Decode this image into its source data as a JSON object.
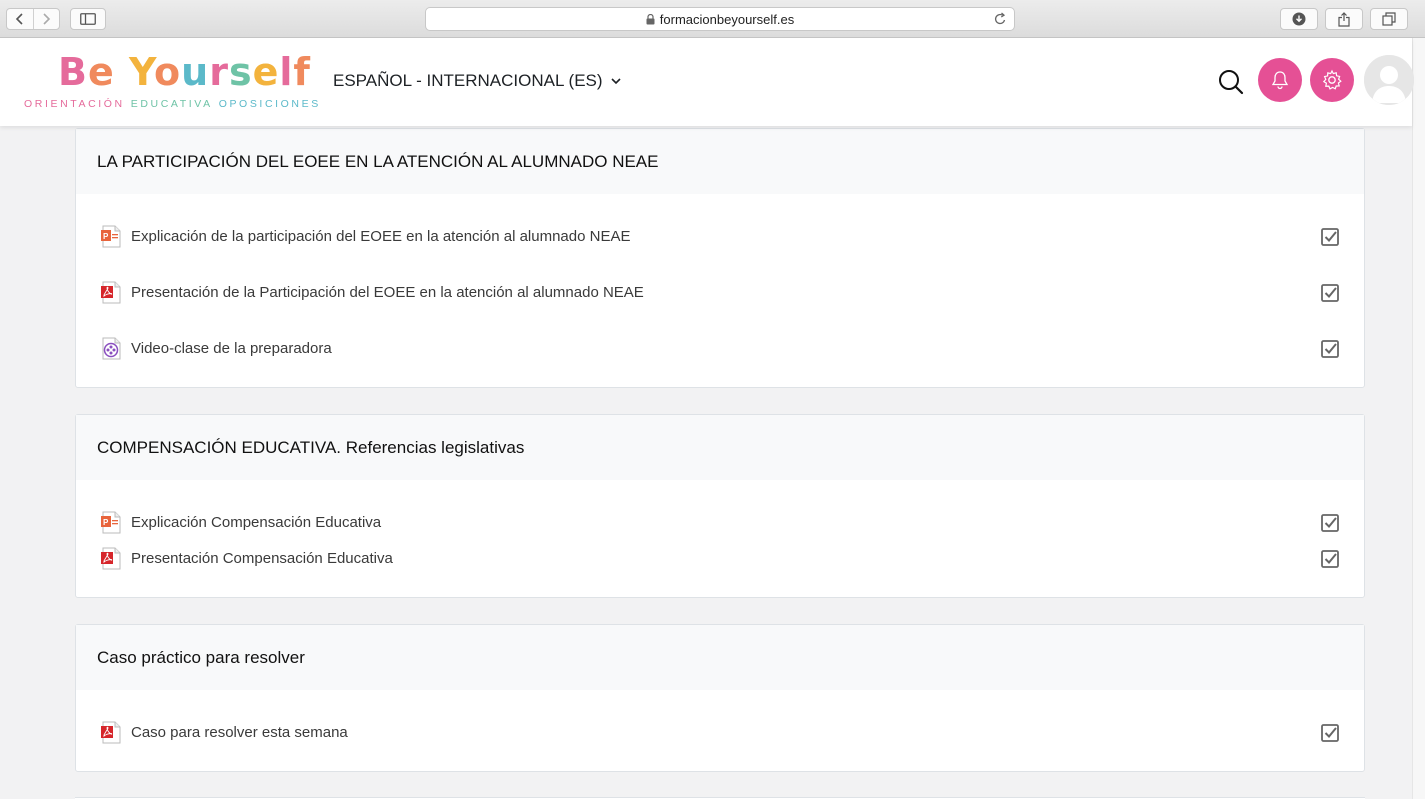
{
  "browser": {
    "url": "formacionbeyourself.es"
  },
  "header": {
    "logo": {
      "word_parts": [
        "B",
        "e",
        " ",
        "Y",
        "o",
        "u",
        "r",
        "s",
        "e",
        "l",
        "f"
      ],
      "word_colors": [
        "#e56b9b",
        "#f08a5d",
        "#ffffff",
        "#f3b33d",
        "#f08a5d",
        "#5bb9c9",
        "#e56b9b",
        "#6ec3a6",
        "#f3b33d",
        "#e56b9b",
        "#f08a5d"
      ],
      "tagline_parts": [
        "ORIENTACIÓN",
        "EDUCATIVA",
        "OPOSICIONES"
      ],
      "tagline_colors": [
        "#e56b9b",
        "#6ec3a6",
        "#5bb9c9"
      ]
    },
    "language": "ESPAÑOL - INTERNACIONAL (ES)",
    "accent_color": "#e55095"
  },
  "sections": [
    {
      "title": "LA PARTICIPACIÓN DEL EOEE EN LA ATENCIÓN AL ALUMNADO NEAE",
      "activities": [
        {
          "type": "powerpoint-icon",
          "title": "Explicación de la participación del EOEE en la atención al alumnado NEAE"
        },
        {
          "type": "pdf-icon",
          "title": "Presentación de la Participación del EOEE en la atención al alumnado NEAE"
        },
        {
          "type": "video-icon",
          "title": "Video-clase de la preparadora"
        }
      ]
    },
    {
      "title": "COMPENSACIÓN EDUCATIVA. Referencias legislativas",
      "activities": [
        {
          "type": "powerpoint-icon",
          "title": "Explicación Compensación Educativa"
        },
        {
          "type": "pdf-icon",
          "title": "Presentación Compensación Educativa"
        }
      ]
    },
    {
      "title": "Caso práctico para resolver",
      "activities": [
        {
          "type": "pdf-icon",
          "title": "Caso para resolver esta semana"
        }
      ]
    }
  ]
}
